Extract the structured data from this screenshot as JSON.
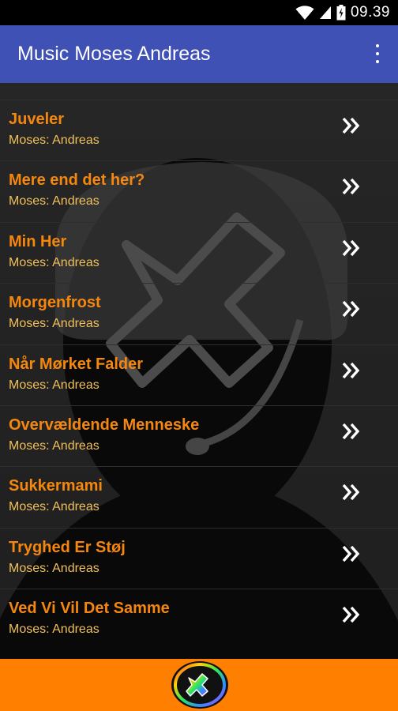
{
  "status": {
    "time": "09.39"
  },
  "app": {
    "title": "Music Moses Andreas"
  },
  "songs": [
    {
      "title": "Juveler",
      "artist": "Moses: Andreas"
    },
    {
      "title": "Mere end det her?",
      "artist": "Moses: Andreas"
    },
    {
      "title": "Min Her",
      "artist": "Moses: Andreas"
    },
    {
      "title": "Morgenfrost",
      "artist": "Moses: Andreas"
    },
    {
      "title": "Når Mørket Falder",
      "artist": "Moses: Andreas"
    },
    {
      "title": "Overvældende Menneske",
      "artist": "Moses: Andreas"
    },
    {
      "title": "Sukkermami",
      "artist": "Moses: Andreas"
    },
    {
      "title": "Tryghed Er Støj",
      "artist": "Moses: Andreas"
    },
    {
      "title": "Ved Vi Vil Det Samme",
      "artist": "Moses: Andreas"
    }
  ],
  "icons": {
    "status": [
      "wifi-icon",
      "signal-icon",
      "battery-icon"
    ],
    "menu": "more-vert-icon",
    "row": "double-chevron-right-icon",
    "footer": "app-logo-icon"
  },
  "colors": {
    "appbar": "#3f51b5",
    "song_title": "#f5870f",
    "artist": "#f0c05a",
    "footer": "#ff7f00"
  }
}
